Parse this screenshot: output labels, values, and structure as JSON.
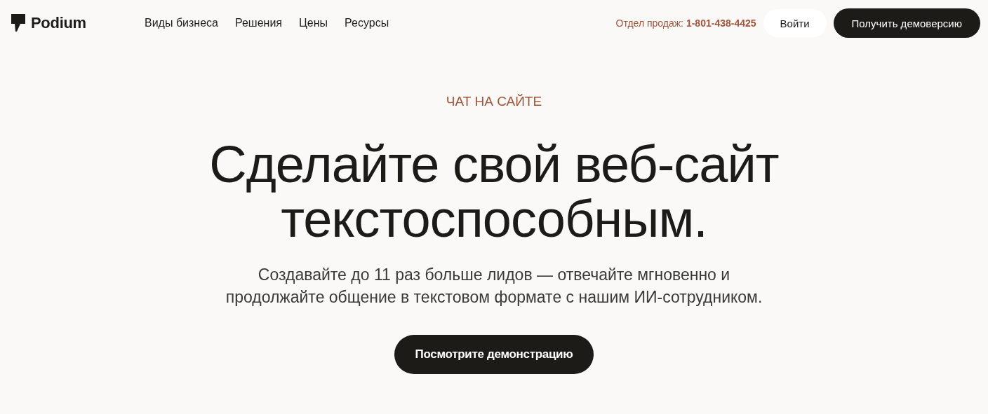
{
  "header": {
    "logo": "Podium",
    "nav": [
      "Виды бизнеса",
      "Решения",
      "Цены",
      "Ресурсы"
    ],
    "sales": "Отдел продаж: **1-801-438-4425**",
    "login": "Войти",
    "demo": "Получить демоверсию"
  },
  "hero": {
    "eyebrow": "ЧАТ НА САЙТЕ",
    "title": [
      "Сделайте свой веб-сайт",
      "текстоспособным."
    ],
    "subtitle": [
      "Создавайте до 11 раз больше лидов — отвечайте мгновенно и",
      "продолжайте общение в текстовом формате с нашим ИИ-сотрудником."
    ],
    "button": "Посмотрите демонстрацию"
  }
}
